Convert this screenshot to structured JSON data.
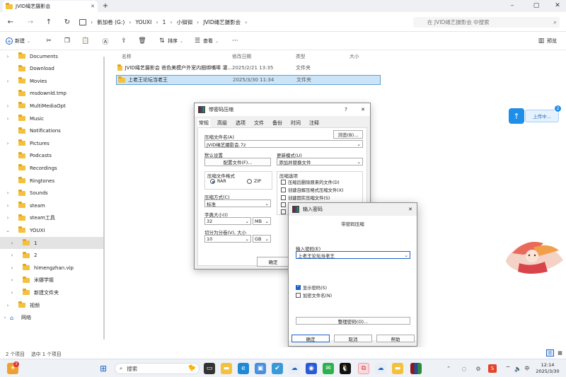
{
  "tab": {
    "title": "JVID绳艺摄影会"
  },
  "window_controls": {
    "minimize": "–",
    "maximize": "▢",
    "close": "✕",
    "new_tab": "+",
    "tab_close": "✕"
  },
  "address": {
    "crumbs": [
      "新加卷 (G:)",
      "YOUXI",
      "1",
      "小钼钼",
      "JVID绳艺摄影会"
    ],
    "search_placeholder": "在 JVID绳艺摄影会 中搜索"
  },
  "toolbar": {
    "new_label": "新建",
    "sort_label": "排序",
    "view_label": "查看",
    "more_label": "···",
    "preview_label": "预览"
  },
  "sidebar": {
    "items": [
      {
        "label": "Documents",
        "chev": "›",
        "indent": 1
      },
      {
        "label": "Download",
        "chev": "",
        "indent": 1
      },
      {
        "label": "Movies",
        "chev": "›",
        "indent": 1
      },
      {
        "label": "msdownld.tmp",
        "chev": "",
        "indent": 1
      },
      {
        "label": "MultiMediaOpt",
        "chev": "›",
        "indent": 1
      },
      {
        "label": "Music",
        "chev": "›",
        "indent": 1
      },
      {
        "label": "Notifications",
        "chev": "",
        "indent": 1
      },
      {
        "label": "Pictures",
        "chev": "›",
        "indent": 1
      },
      {
        "label": "Podcasts",
        "chev": "",
        "indent": 1
      },
      {
        "label": "Recordings",
        "chev": "",
        "indent": 1
      },
      {
        "label": "Ringtones",
        "chev": "",
        "indent": 1
      },
      {
        "label": "Sounds",
        "chev": "›",
        "indent": 1
      },
      {
        "label": "steam",
        "chev": "›",
        "indent": 1
      },
      {
        "label": "steam工具",
        "chev": "›",
        "indent": 1
      },
      {
        "label": "YOUXI",
        "chev": "⌄",
        "indent": 1
      },
      {
        "label": "1",
        "chev": "›",
        "indent": 2,
        "selected": true
      },
      {
        "label": "2",
        "chev": "›",
        "indent": 2
      },
      {
        "label": "himengzhan.vip",
        "chev": "›",
        "indent": 2
      },
      {
        "label": "米娜学姐",
        "chev": "›",
        "indent": 2
      },
      {
        "label": "新建文件夹",
        "chev": "›",
        "indent": 2
      },
      {
        "label": "视频",
        "chev": "›",
        "indent": 1
      },
      {
        "label": "网络",
        "chev": "›",
        "indent": 0,
        "network": true
      }
    ]
  },
  "columns": {
    "name": "名称",
    "date": "修改日期",
    "type": "类型",
    "size": "大小"
  },
  "files": [
    {
      "name": "JVID绳艺摄影会 爸色美模户外室内捆绑嘴唪 灌...",
      "date": "2025/2/21 13:35",
      "type": "文件夹"
    },
    {
      "name": "上老王论坛当老王",
      "date": "2025/3/30 11:34",
      "type": "文件夹",
      "selected": true
    }
  ],
  "status": {
    "count": "2 个项目",
    "selected": "选中 1 个项目"
  },
  "upload": {
    "label": "上传中...",
    "badge": "2"
  },
  "dialog1": {
    "title": "带密码压缩",
    "help": "?",
    "close": "✕",
    "tabs": [
      "常规",
      "高级",
      "选项",
      "文件",
      "备份",
      "时间",
      "注释"
    ],
    "archive_name_label": "压缩文件名(A)",
    "browse": "浏览(B)...",
    "archive_name": "JVID绳艺摄影会.7z",
    "profiles_label": "默认设置",
    "profiles_btn": "配置文件(F)...",
    "update_label": "更新模式(U)",
    "update_value": "添加并替换文件",
    "format_label": "压缩文件格式",
    "format_rar": "RAR",
    "format_zip": "ZIP",
    "options_label": "压缩选项",
    "options": [
      {
        "label": "压缩后删除原来的文件(D)"
      },
      {
        "label": "创建自解压格式压缩文件(X)"
      },
      {
        "label": "创建固实压缩文件(S)"
      }
    ],
    "method_label": "压缩方式(C)",
    "method_value": "标准",
    "dict_label": "字典大小(I)",
    "dict_value": "32",
    "dict_unit": "MB",
    "split_label": "切分为分卷(V), 大小",
    "split_value": "10",
    "split_unit": "GB",
    "ok": "确定"
  },
  "dialog2": {
    "title": "输入密码",
    "close": "✕",
    "heading": "带密码压缩",
    "pwd_label": "输入密码(E)",
    "pwd_value": "上老王论坛当老王",
    "show_pwd": "显示密码(S)",
    "encrypt_names": "加密文件名(N)",
    "organize": "整理密码(O)...",
    "ok": "确定",
    "cancel": "取消",
    "help": "帮助"
  },
  "taskbar": {
    "search_label": "搜索",
    "time": "12:14",
    "date": "2025/3/30",
    "lang": "中",
    "badge": "3"
  }
}
